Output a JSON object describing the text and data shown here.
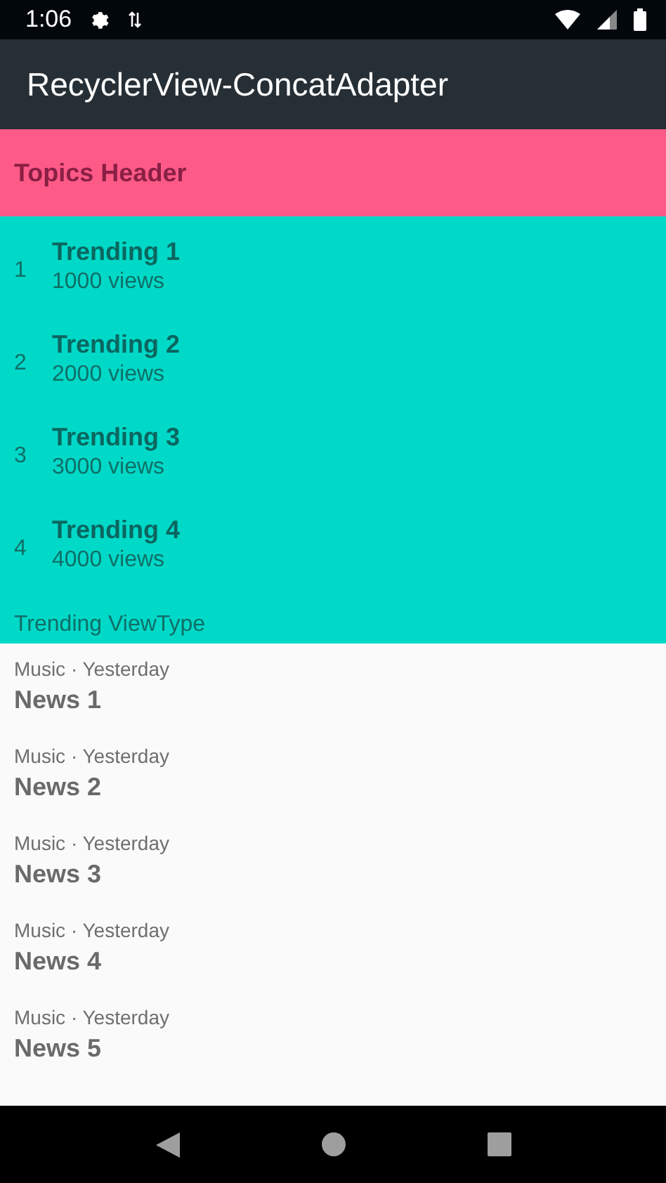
{
  "status_bar": {
    "time": "1:06"
  },
  "app_bar": {
    "title": "RecyclerView-ConcatAdapter"
  },
  "topics_header": {
    "title": "Topics Header"
  },
  "trending": {
    "items": [
      {
        "rank": "1",
        "title": "Trending 1",
        "views": "1000 views"
      },
      {
        "rank": "2",
        "title": "Trending 2",
        "views": "2000 views"
      },
      {
        "rank": "3",
        "title": "Trending 3",
        "views": "3000 views"
      },
      {
        "rank": "4",
        "title": "Trending 4",
        "views": "4000 views"
      }
    ],
    "footer": "Trending ViewType"
  },
  "news": [
    {
      "meta": "Music · Yesterday",
      "title": "News 1"
    },
    {
      "meta": "Music · Yesterday",
      "title": "News 2"
    },
    {
      "meta": "Music · Yesterday",
      "title": "News 3"
    },
    {
      "meta": "Music · Yesterday",
      "title": "News 4"
    },
    {
      "meta": "Music · Yesterday",
      "title": "News 5"
    }
  ]
}
